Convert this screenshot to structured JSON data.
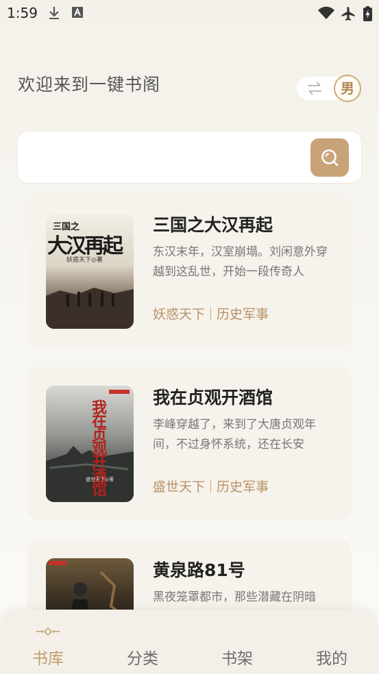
{
  "status_bar": {
    "time": "1:59"
  },
  "header": {
    "welcome": "欢迎来到一键书阁",
    "gender": "男"
  },
  "search": {
    "value": "",
    "placeholder": ""
  },
  "books": [
    {
      "title": "三国之大汉再起",
      "desc": "东汉末年，汉室崩塌。刘闲意外穿越到这乱世，开始一段传奇人",
      "author": "妖惑天下",
      "category": "历史军事",
      "cover_text": {
        "top": "三国之",
        "main": "大汉再起",
        "author": "妖惑天下◎著"
      }
    },
    {
      "title": "我在贞观开酒馆",
      "desc": "李峰穿越了，来到了大唐贞观年间，不过身怀系统，还在长安",
      "author": "盛世天下",
      "category": "历史军事",
      "cover_text": {
        "main": "我在贞观开酒馆",
        "author": "盛世天下◎著"
      }
    },
    {
      "title": "黄泉路81号",
      "desc": "黑夜笼罩都市，那些潜藏在阴暗",
      "author": "",
      "category": "",
      "cover_text": {}
    }
  ],
  "nav": {
    "items": [
      {
        "label": "书库",
        "active": true
      },
      {
        "label": "分类",
        "active": false
      },
      {
        "label": "书架",
        "active": false
      },
      {
        "label": "我的",
        "active": false
      }
    ]
  },
  "colors": {
    "accent": "#c19a6b",
    "search_button": "#c9a378",
    "card_bg": "#f6f2ec"
  },
  "icons": [
    "download-icon",
    "font-icon",
    "wifi-icon",
    "airplane-icon",
    "battery-icon",
    "swap-icon",
    "search-icon"
  ]
}
